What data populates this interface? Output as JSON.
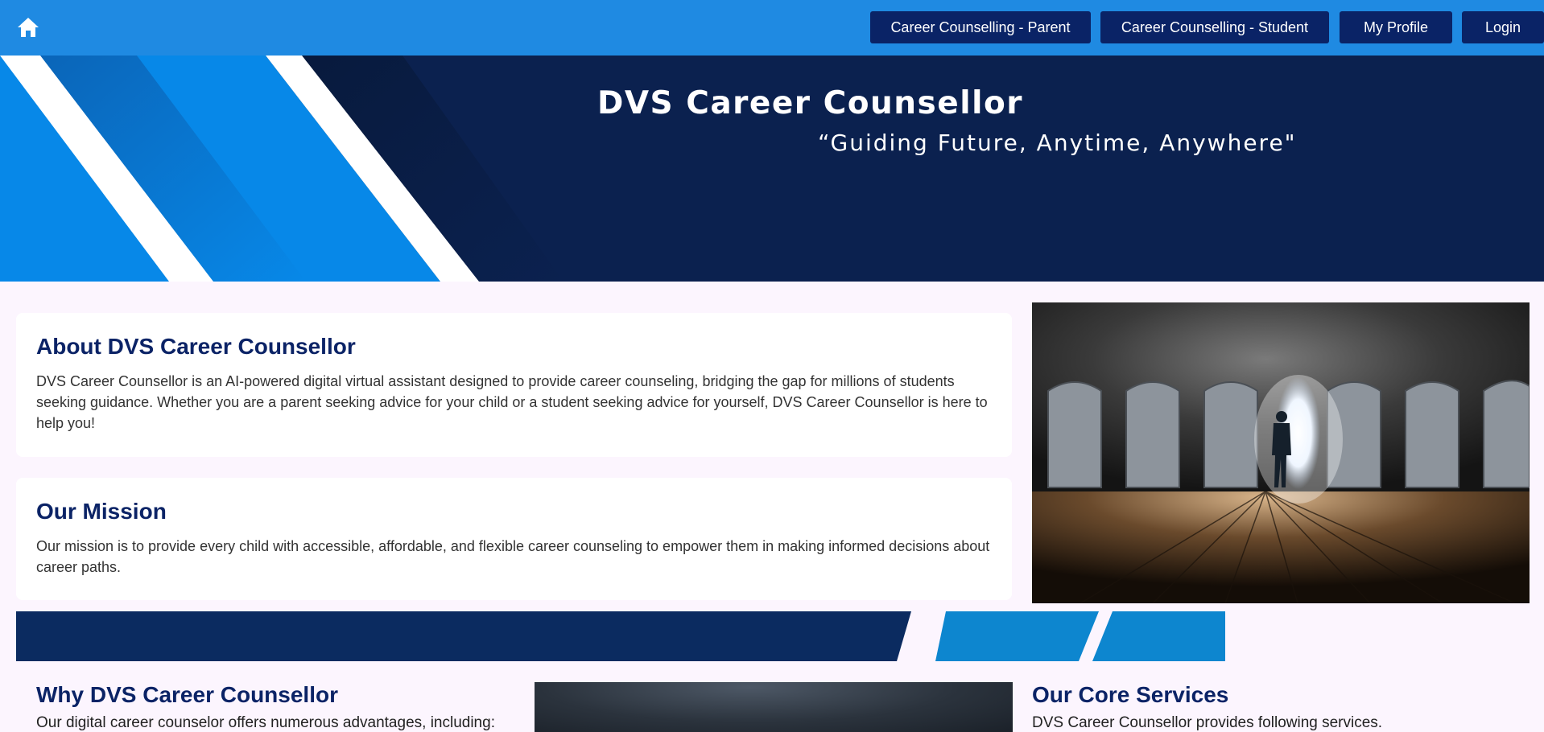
{
  "nav": {
    "items": [
      {
        "label": "Career Counselling - Parent"
      },
      {
        "label": "Career Counselling - Student"
      },
      {
        "label": "My Profile"
      },
      {
        "label": "Login"
      }
    ],
    "home_icon": "home-icon"
  },
  "hero": {
    "title": "DVS Career Counsellor",
    "tagline": "“Guiding Future, Anytime, Anywhere\""
  },
  "about": {
    "heading": "About DVS Career Counsellor",
    "body": "DVS Career Counsellor is an AI-powered digital virtual assistant designed to provide career counseling, bridging the gap for millions of students seeking guidance. Whether you are a parent seeking advice for your child or a student seeking advice for yourself, DVS Career Counsellor is here to help you!"
  },
  "mission": {
    "heading": "Our Mission",
    "body": "Our mission is to provide every child with accessible, affordable, and flexible career counseling to empower them in making informed decisions about career paths."
  },
  "why": {
    "heading": "Why DVS Career Counsellor",
    "intro": "Our digital career counselor offers numerous advantages, including:"
  },
  "services": {
    "heading": "Our Core Services",
    "intro": "DVS Career Counsellor provides following services."
  },
  "colors": {
    "nav_bar": "#1f8ae2",
    "nav_button": "#0a2366",
    "hero_navy": "#0b214f",
    "hero_blue": "#0788e8",
    "heading": "#0b2366",
    "page_bg": "#fcf5fe"
  }
}
